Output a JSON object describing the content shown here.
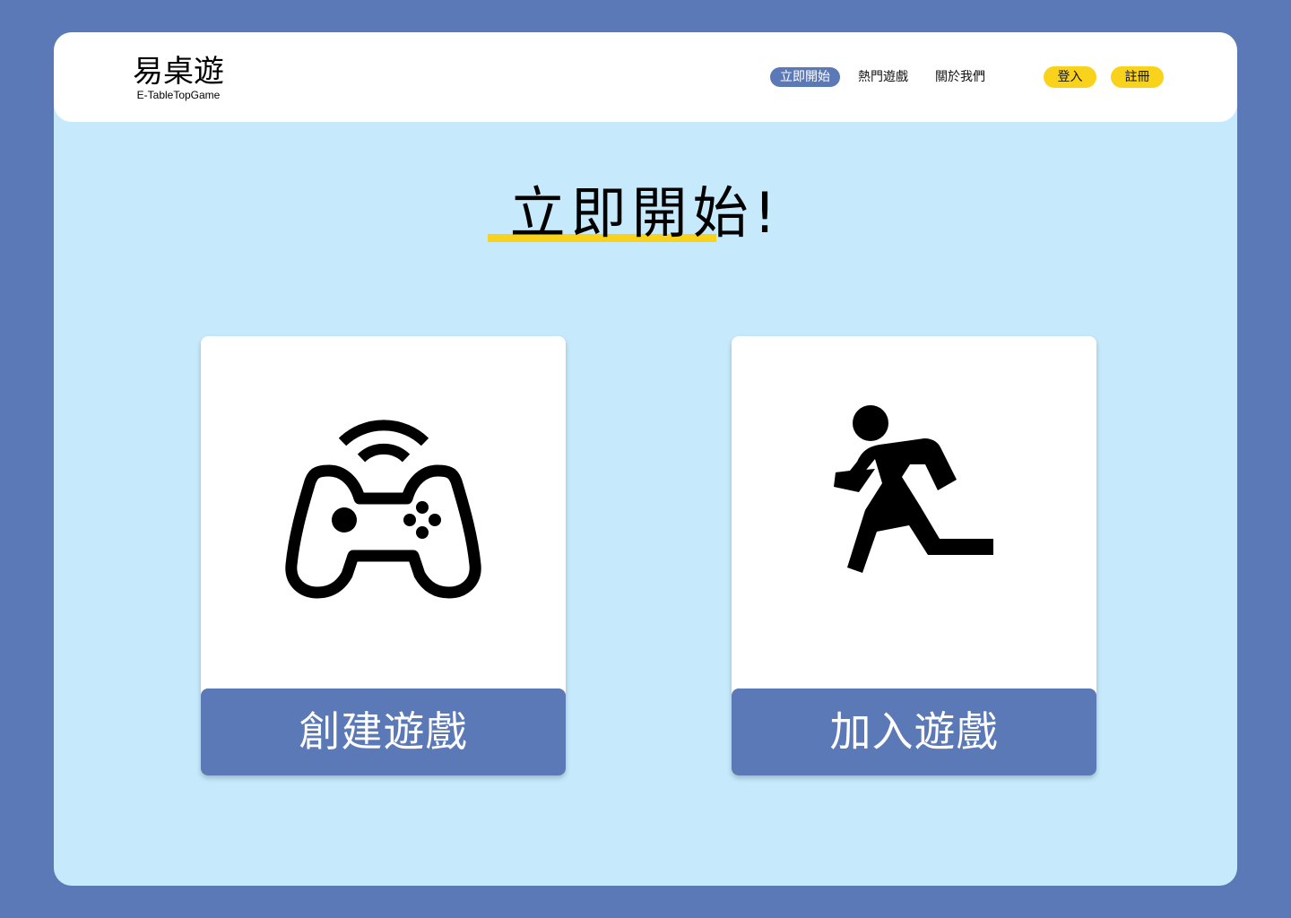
{
  "header": {
    "logo_title": "易桌遊",
    "logo_subtitle": "E-TableTopGame",
    "nav": [
      {
        "label": "立即開始",
        "active": true
      },
      {
        "label": "熱門遊戲",
        "active": false
      },
      {
        "label": "關於我們",
        "active": false
      }
    ],
    "login_label": "登入",
    "register_label": "註冊"
  },
  "hero": {
    "title": "立即開始!"
  },
  "cards": [
    {
      "icon": "gamepad-wireless-icon",
      "label": "創建遊戲"
    },
    {
      "icon": "running-person-icon",
      "label": "加入遊戲"
    }
  ],
  "colors": {
    "outer_background": "#5b79b6",
    "page_background": "#c6eafc",
    "accent_blue": "#5b79b6",
    "accent_yellow": "#f9d31b",
    "card_background": "#ffffff"
  }
}
